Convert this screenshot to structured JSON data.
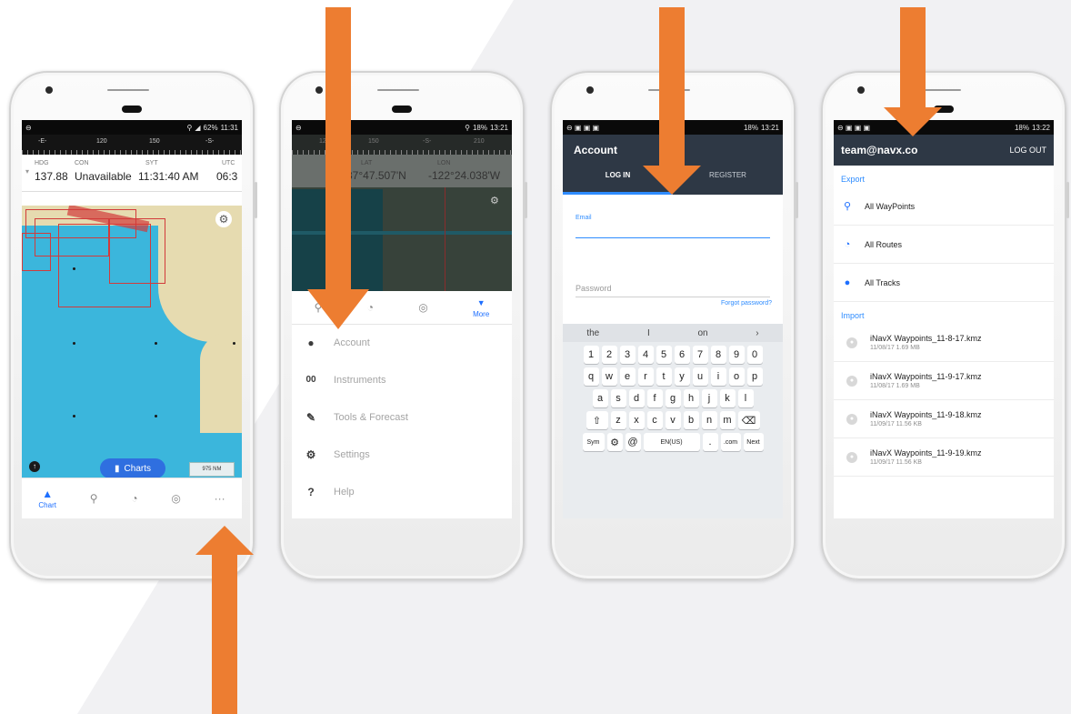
{
  "colors": {
    "arrow": "#ED7D31",
    "nav_header": "#2E3845",
    "accent": "#2E8CFF",
    "map_water": "#3BB6DC"
  },
  "screen1": {
    "status_time": "11:31",
    "status_battery": "62%",
    "ruler": [
      "-E-",
      "120",
      "150",
      "-S-"
    ],
    "instruments": [
      {
        "label": "HDG",
        "value": "137.88"
      },
      {
        "label": "CON",
        "value": "Unavailable"
      },
      {
        "label": "SYT",
        "value": "11:31:40 AM"
      },
      {
        "label": "UTC",
        "value": "06:3"
      }
    ],
    "charts_button": "Charts",
    "scale": "975 NM",
    "tabs": {
      "chart": "Chart",
      "more": "···"
    }
  },
  "screen2": {
    "status_time": "13:21",
    "status_battery": "18%",
    "ruler": [
      "120",
      "150",
      "-S-",
      "210"
    ],
    "lat_label": "LAT",
    "lat_value": "37°47.507'N",
    "lon_label": "LON",
    "lon_value": "-122°24.038'W",
    "more_tab": "More",
    "menu": {
      "account": "Account",
      "instruments": "Instruments",
      "tools": "Tools & Forecast",
      "settings": "Settings",
      "help": "Help"
    }
  },
  "screen3": {
    "status_time": "13:21",
    "status_battery": "18%",
    "title": "Account",
    "tab_login": "LOG IN",
    "tab_register": "REGISTER",
    "email_label": "Email",
    "password_label": "Password",
    "forgot": "Forgot password?",
    "suggestions": [
      "the",
      "I",
      "on"
    ],
    "keys_row1": [
      "1",
      "2",
      "3",
      "4",
      "5",
      "6",
      "7",
      "8",
      "9",
      "0"
    ],
    "keys_row2": [
      "q",
      "w",
      "e",
      "r",
      "t",
      "y",
      "u",
      "i",
      "o",
      "p"
    ],
    "keys_row3": [
      "a",
      "s",
      "d",
      "f",
      "g",
      "h",
      "j",
      "k",
      "l"
    ],
    "keys_row4": [
      "z",
      "x",
      "c",
      "v",
      "b",
      "n",
      "m"
    ],
    "key_sym": "Sym",
    "key_lang": "EN(US)",
    "key_com": ".com",
    "key_next": "Next"
  },
  "screen4": {
    "status_time": "13:22",
    "status_battery": "18%",
    "email": "team@navx.co",
    "logout": "LOG OUT",
    "export_header": "Export",
    "export_items": [
      "All WayPoints",
      "All Routes",
      "All Tracks"
    ],
    "import_header": "Import",
    "files": [
      {
        "name": "iNavX Waypoints_11-8-17.kmz",
        "meta": "11/08/17   1.69 MB"
      },
      {
        "name": "iNavX Waypoints_11-9-17.kmz",
        "meta": "11/08/17   1.69 MB"
      },
      {
        "name": "iNavX Waypoints_11-9-18.kmz",
        "meta": "11/09/17   11.56 KB"
      },
      {
        "name": "iNavX Waypoints_11-9-19.kmz",
        "meta": "11/09/17   11.56 KB"
      }
    ]
  }
}
